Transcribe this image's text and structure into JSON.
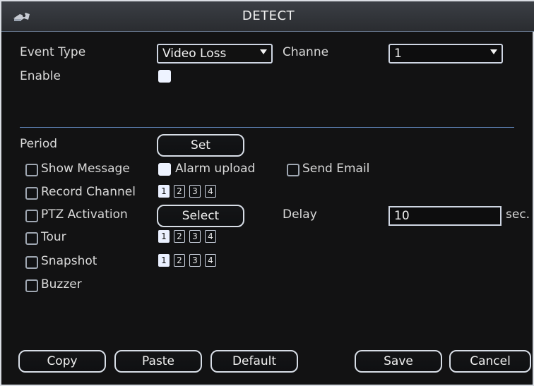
{
  "window": {
    "title": "DETECT",
    "logo_icon": "camera-icon"
  },
  "event": {
    "event_type_label": "Event Type",
    "event_type_value": "Video Loss",
    "channel_label": "Channe",
    "channel_value": "1",
    "enable_label": "Enable",
    "enable_checked": true
  },
  "rules": {
    "period_label": "Period",
    "period_button": "Set",
    "show_message_label": "Show Message",
    "show_message_checked": false,
    "alarm_upload_label": "Alarm upload",
    "alarm_upload_checked": true,
    "send_email_label": "Send Email",
    "send_email_checked": false,
    "record_channel_label": "Record Channel",
    "record_channel_checked": false,
    "ptz_activation_label": "PTZ Activation",
    "ptz_activation_checked": false,
    "ptz_button": "Select",
    "delay_label": "Delay",
    "delay_value": "10",
    "delay_unit": "sec.",
    "tour_label": "Tour",
    "tour_checked": false,
    "snapshot_label": "Snapshot",
    "snapshot_checked": false,
    "buzzer_label": "Buzzer",
    "buzzer_checked": false,
    "channel_chips": [
      "1",
      "2",
      "3",
      "4"
    ]
  },
  "footer": {
    "copy": "Copy",
    "paste": "Paste",
    "default": "Default",
    "save": "Save",
    "cancel": "Cancel"
  }
}
